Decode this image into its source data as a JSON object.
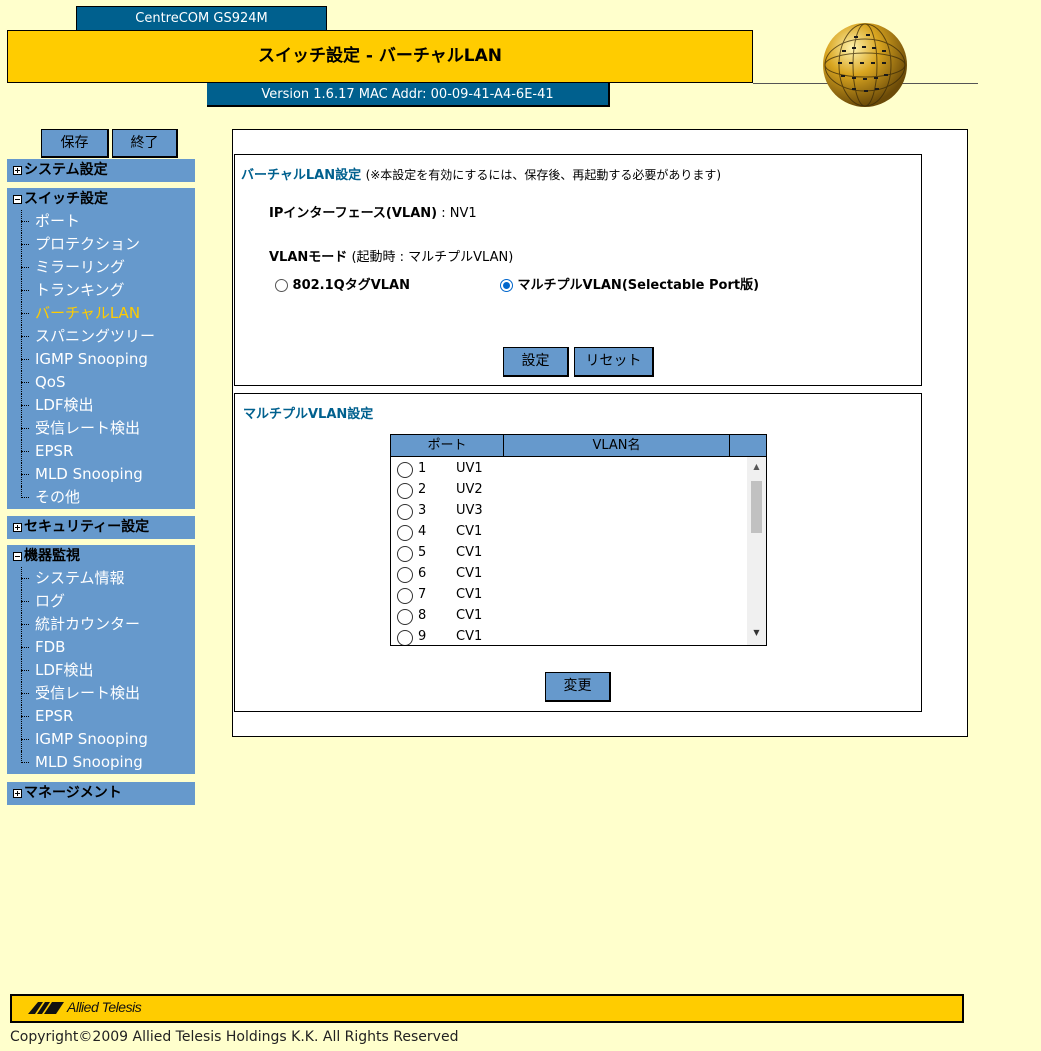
{
  "header": {
    "model": "CentreCOM GS924M",
    "title": "スイッチ設定 - バーチャルLAN",
    "version": "Version 1.6.17 MAC Addr: 00-09-41-A4-6E-41"
  },
  "toolbar": {
    "save_label": "保存",
    "exit_label": "終了"
  },
  "sidebar": {
    "system": {
      "label": "システム設定",
      "expanded": false
    },
    "switch": {
      "label": "スイッチ設定",
      "expanded": true,
      "items": [
        "ポート",
        "プロテクション",
        "ミラーリング",
        "トランキング",
        "バーチャルLAN",
        "スパニングツリー",
        "IGMP Snooping",
        "QoS",
        "LDF検出",
        "受信レート検出",
        "EPSR",
        "MLD Snooping",
        "その他"
      ],
      "active": "バーチャルLAN"
    },
    "security": {
      "label": "セキュリティー設定",
      "expanded": false
    },
    "monitor": {
      "label": "機器監視",
      "expanded": true,
      "items": [
        "システム情報",
        "ログ",
        "統計カウンター",
        "FDB",
        "LDF検出",
        "受信レート検出",
        "EPSR",
        "IGMP Snooping",
        "MLD Snooping"
      ]
    },
    "management": {
      "label": "マネージメント",
      "expanded": false
    }
  },
  "vlan_settings": {
    "title": "バーチャルLAN設定",
    "note": "(※本設定を有効にするには、保存後、再起動する必要があります)",
    "ip_interface_label": "IPインターフェース(VLAN)",
    "ip_interface_sep": " : ",
    "ip_interface_value": "NV1",
    "mode_label": "VLANモード",
    "mode_note": "(起動時 : マルチプルVLAN)",
    "option_tag": "802.1QタグVLAN",
    "option_multi": "マルチプルVLAN(Selectable Port版)",
    "selected": "multi",
    "set_label": "設定",
    "reset_label": "リセット"
  },
  "multiple_vlan": {
    "title": "マルチプルVLAN設定",
    "col_port": "ポート",
    "col_vlan": "VLAN名",
    "rows": [
      {
        "port": "1",
        "vlan": "UV1"
      },
      {
        "port": "2",
        "vlan": "UV2"
      },
      {
        "port": "3",
        "vlan": "UV3"
      },
      {
        "port": "4",
        "vlan": "CV1"
      },
      {
        "port": "5",
        "vlan": "CV1"
      },
      {
        "port": "6",
        "vlan": "CV1"
      },
      {
        "port": "7",
        "vlan": "CV1"
      },
      {
        "port": "8",
        "vlan": "CV1"
      },
      {
        "port": "9",
        "vlan": "CV1"
      }
    ],
    "change_label": "変更"
  },
  "footer": {
    "brand": "Allied Telesis",
    "copyright": "Copyright©2009 Allied Telesis Holdings K.K. All Rights Reserved"
  },
  "colors": {
    "background": "#ffffcc",
    "accent_yellow": "#ffcc00",
    "navy": "#00608e",
    "menu_blue": "#6699cc",
    "active_item": "#ffcc00"
  }
}
